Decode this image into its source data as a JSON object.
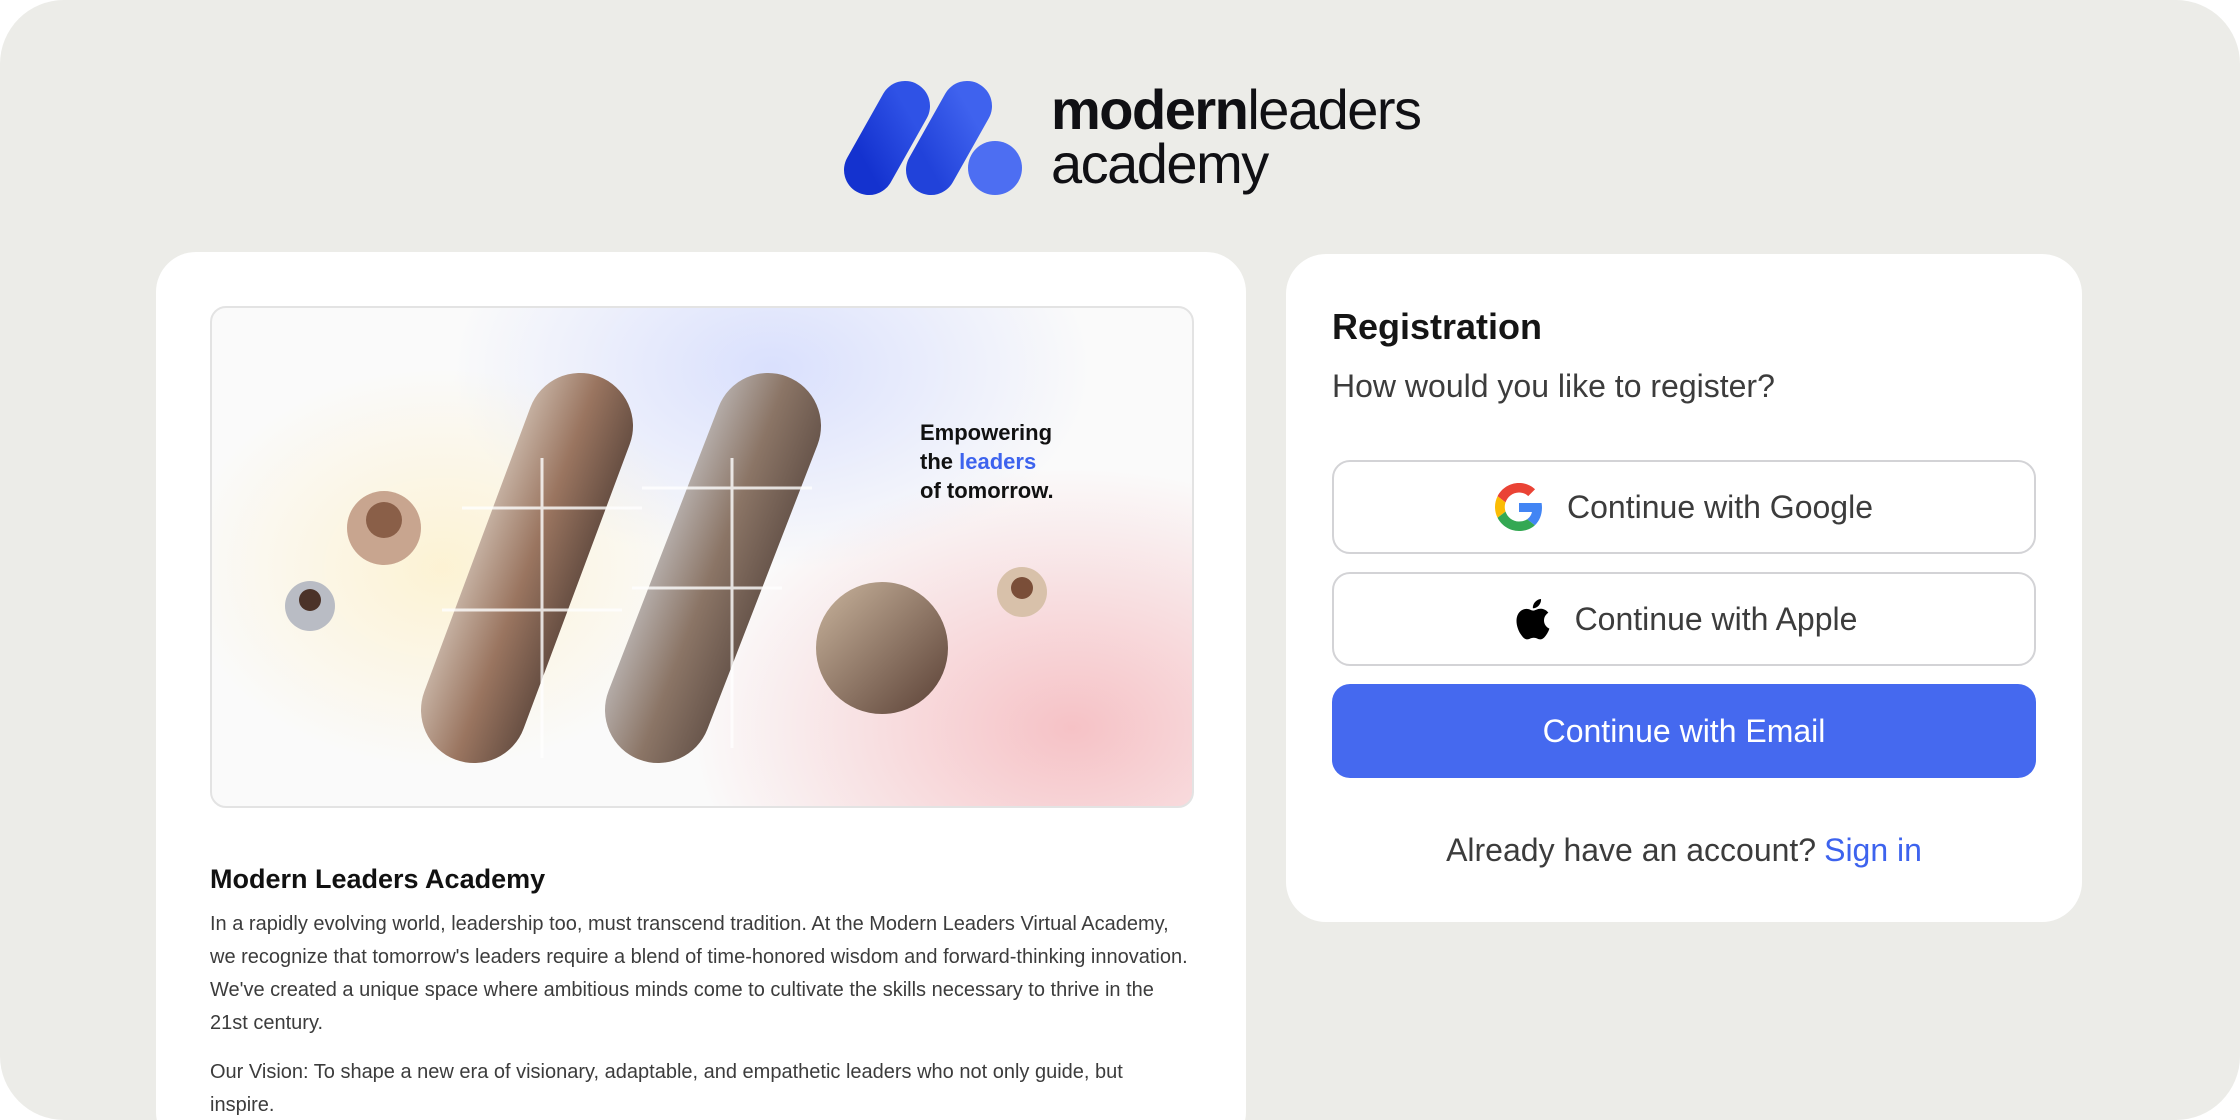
{
  "brand": {
    "name_bold": "modern",
    "name_regular": "leaders",
    "name_line2": "academy",
    "colors": {
      "mark_dark": "#1f3fd6",
      "mark_light": "#4d6ef2"
    }
  },
  "hero": {
    "tagline_line1": "Empowering",
    "tagline_the": "the",
    "tagline_highlight": "leaders",
    "tagline_line3": "of tomorrow."
  },
  "about": {
    "title": "Modern Leaders Academy",
    "paragraph1": "In a rapidly evolving world, leadership too, must transcend tradition. At the Modern Leaders Virtual Academy, we recognize that tomorrow's leaders require a blend of time-honored wisdom and forward-thinking innovation. We've created a unique space where ambitious minds come to cultivate the skills necessary to thrive in the 21st century.",
    "paragraph2": "Our Vision: To shape a new era of visionary, adaptable, and empathetic leaders who not only guide, but inspire."
  },
  "registration": {
    "title": "Registration",
    "subtitle": "How would you like to register?",
    "google_label": "Continue with Google",
    "apple_label": "Continue with Apple",
    "email_label": "Continue with Email",
    "signin_prompt": "Already have an account?",
    "signin_link": "Sign in",
    "accent_color": "#4569ef"
  }
}
